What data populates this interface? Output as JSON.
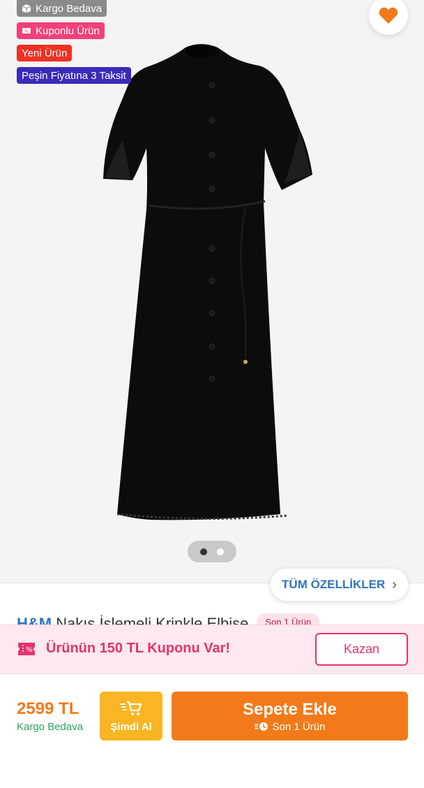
{
  "badges": {
    "free_shipping": "Kargo Bedava",
    "coupon_product": "Kuponlu Ürün",
    "new_product": "Yeni Ürün",
    "installments": "Peşin Fiyatına 3 Taksit"
  },
  "gallery": {
    "image_alt": "black dress product image",
    "page_count": 2,
    "active_index": 0
  },
  "features_button": {
    "label": "TÜM ÖZELLİKLER"
  },
  "product": {
    "brand": "H&M",
    "title": "Nakış İşlemeli Krinkle Elbise",
    "stock_note": "Son 1 Ürün"
  },
  "coupon": {
    "text": "Ürünün 150 TL Kuponu Var!",
    "button_label": "Kazan"
  },
  "purchase": {
    "price": "2599 TL",
    "shipping": "Kargo Bedava",
    "buy_now_label": "Şimdi Al",
    "add_to_cart_label": "Sepete Ekle",
    "stock_label": "Son 1 Ürün"
  },
  "colors": {
    "accent_orange": "#f27a1a",
    "coupon_pink": "#e5336d",
    "brand_blue": "#2f74c0",
    "buy_now_yellow": "#f9b523",
    "shipping_green": "#2fa35a"
  },
  "icons": [
    "box-icon",
    "coupon-tag-icon",
    "heart-icon",
    "chevron-right-icon",
    "coupon-icon",
    "fast-cart-icon",
    "fast-clock-icon"
  ]
}
